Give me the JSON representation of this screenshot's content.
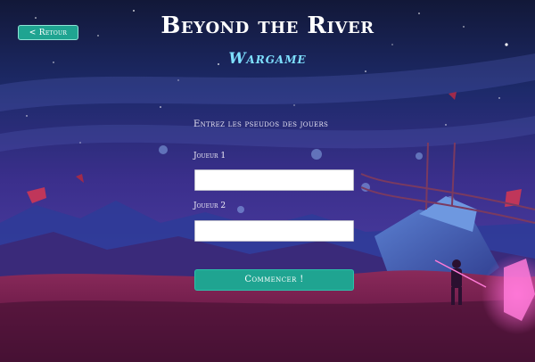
{
  "header": {
    "back_label": "< Retour",
    "title": "Beyond the River",
    "subtitle": "Wargame"
  },
  "form": {
    "prompt": "Entrez les pseudos des jouers",
    "player1_label": "Joueur 1",
    "player1_value": "",
    "player2_label": "Joueur 2",
    "player2_value": "",
    "start_label": "Commencer !"
  },
  "colors": {
    "accent": "#1fa491",
    "subtitle": "#7ee0ff",
    "sky_top": "#141a3e",
    "sky_mid": "#3a2f8a",
    "ground": "#6e1a4a"
  }
}
